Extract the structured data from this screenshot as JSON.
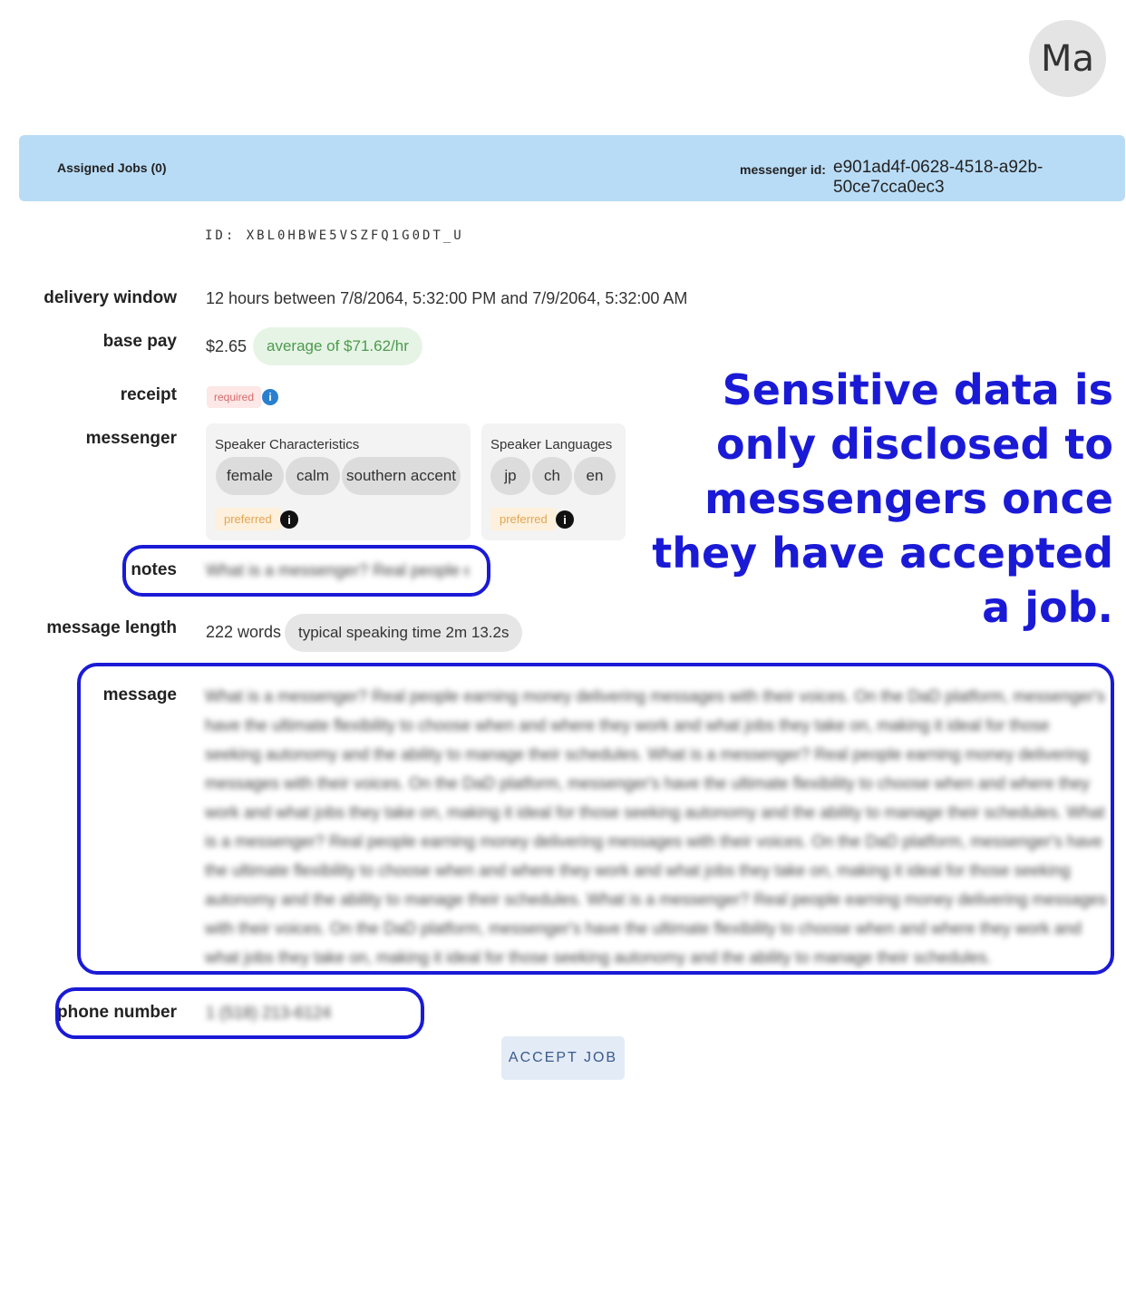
{
  "avatar": {
    "initials": "Ma"
  },
  "header": {
    "assigned_jobs": "Assigned Jobs (0)",
    "messenger_id_label": "messenger id:",
    "messenger_id_value": "e901ad4f-0628-4518-a92b-50ce7cca0ec3"
  },
  "job": {
    "id": "ID: XBL0HBWE5VSZFQ1G0DT_U",
    "delivery_window_label": "delivery window",
    "delivery_window_value": "12 hours between 7/8/2064, 5:32:00 PM and 7/9/2064, 5:32:00 AM",
    "base_pay_label": "base pay",
    "base_pay_value": "$2.65",
    "base_pay_average": "average of $71.62/hr",
    "receipt_label": "receipt",
    "receipt_tag": "required",
    "messenger_label": "messenger",
    "speaker_characteristics_title": "Speaker Characteristics",
    "characteristics": [
      "female",
      "calm",
      "southern accent"
    ],
    "speaker_languages_title": "Speaker Languages",
    "languages": [
      "jp",
      "ch",
      "en"
    ],
    "preferred_tag": "preferred",
    "notes_label": "notes",
    "notes_value": "What is a messenger? Real people earn",
    "message_length_label": "message length",
    "message_length_value": "222 words",
    "speaking_time": "typical speaking time 2m 13.2s",
    "message_label": "message",
    "message_value": "What is a messenger? Real people earning money delivering messages with their voices. On the DaD platform, messenger's have the ultimate flexibility to choose when and where they work and what jobs they take on, making it ideal for those seeking autonomy and the ability to manage their schedules. What is a messenger? Real people earning money delivering messages with their voices. On the DaD platform, messenger's have the ultimate flexibility to choose when and where they work and what jobs they take on, making it ideal for those seeking autonomy and the ability to manage their schedules. What is a messenger? Real people earning money delivering messages with their voices. On the DaD platform, messenger's have the ultimate flexibility to choose when and where they work and what jobs they take on, making it ideal for those seeking autonomy and the ability to manage their schedules. What is a messenger? Real people earning money delivering messages with their voices. On the DaD platform, messenger's have the ultimate flexibility to choose when and where they work and what jobs they take on, making it ideal for those seeking autonomy and the ability to manage their schedules.",
    "phone_label": "phone number",
    "phone_value": "1 (518) 213-6124"
  },
  "accept_button": "ACCEPT JOB",
  "annotation": "Sensitive data is only disclosed to messengers once they have accepted a job.",
  "colors": {
    "accent": "#1a1ad6",
    "topbar": "#b9dcf6"
  }
}
